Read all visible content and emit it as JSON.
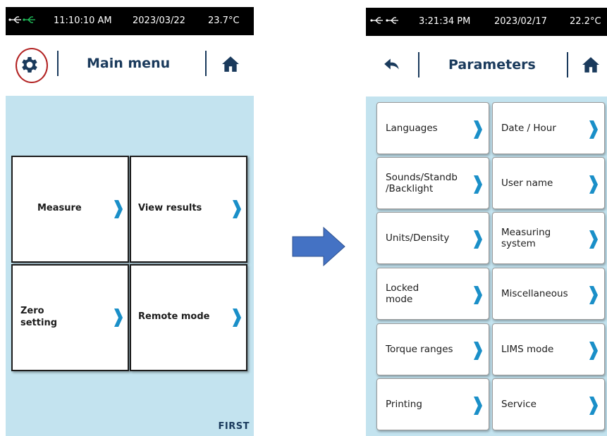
{
  "left_screen": {
    "status": {
      "time": "11:10:10 AM",
      "date": "2023/03/22",
      "temperature": "23.7°C"
    },
    "header": {
      "title": "Main menu",
      "settings_icon": "gear-icon",
      "home_icon": "home-icon"
    },
    "tiles": [
      {
        "label": "Measure"
      },
      {
        "label": "View results"
      },
      {
        "label": "Zero\nsetting"
      },
      {
        "label": "Remote mode"
      }
    ],
    "brand": "FIRST"
  },
  "right_screen": {
    "status": {
      "time": "3:21:34 PM",
      "date": "2023/02/17",
      "temperature": "22.2°C"
    },
    "header": {
      "title": "Parameters",
      "back_icon": "back-arrow-icon",
      "home_icon": "home-icon"
    },
    "buttons": [
      {
        "label": "Languages"
      },
      {
        "label": "Date / Hour"
      },
      {
        "label": "Sounds/Standb\n/Backlight"
      },
      {
        "label": "User name"
      },
      {
        "label": "Units/Density"
      },
      {
        "label": "Measuring\nsystem"
      },
      {
        "label": "Locked\nmode"
      },
      {
        "label": "Miscellaneous"
      },
      {
        "label": "Torque ranges"
      },
      {
        "label": "LIMS mode"
      },
      {
        "label": "Printing"
      },
      {
        "label": "Service"
      }
    ]
  },
  "colors": {
    "accent_chevron": "#1a8fc8",
    "header_text": "#1a3a5c",
    "content_bg": "#c3e3ef",
    "highlight_ring": "#b22222",
    "arrow_fill": "#4472c4",
    "usb_connected": "#22c55e"
  }
}
